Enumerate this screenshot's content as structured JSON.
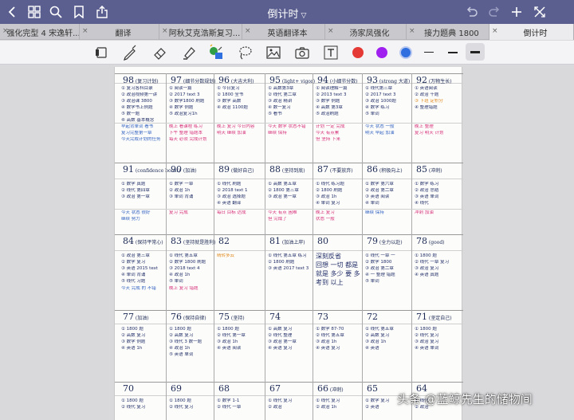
{
  "window": {
    "title": "倒计时"
  },
  "tabs": [
    {
      "label": "强化完型 4 宋逸轩..."
    },
    {
      "label": "翻译"
    },
    {
      "label": "阿秋艾克浩斯复习..."
    },
    {
      "label": "英语翻译本"
    },
    {
      "label": "汤家凤强化"
    },
    {
      "label": "接力题典 1800"
    },
    {
      "label": "倒计时"
    }
  ],
  "colors": {
    "titlebar": "#5b5f8f",
    "red": "#e53935",
    "purple": "#a020f0",
    "blue": "#2f6fe0"
  },
  "page": {
    "row1": {
      "heads": [
        "98",
        "97",
        "96",
        "95",
        "94",
        "93",
        "92"
      ],
      "subs": [
        "(复习计划)",
        "(细节分数规划)",
        "(大吉大利)",
        "(light+ vigor)",
        "(小细节分数)",
        "(strong 大道)",
        "(万物生长)"
      ],
      "lines": [
        [
          "① 复习各科目录",
          "② 政治视频第一讲",
          "③ 政治课 3800",
          "④ 数学书上例题",
          "⑤ 数一题",
          "⑥ 高数 基本概念"
        ],
        [
          "① 阅读一篇",
          "② 2017 text 3",
          "③ 数学1800 刷题",
          "④ 数学 例题",
          "⑤ 政治复习1h"
        ],
        [
          "① 今日复习",
          "② 1800 全书",
          "③ 数学 高数",
          "④ 政治 1100题"
        ],
        [
          "① 高数第3章",
          "② 线代 第二章",
          "③ 政治 精讲",
          "④ 数一复习",
          "⑤ 看书"
        ],
        [
          "① 阅读理解一篇",
          "② 2013 text 3",
          "③ 数学 例题",
          "④ 高数 第3章",
          "⑤ 政治刷题"
        ],
        [
          "① 线代第三章",
          "② 2017 text 3",
          "③ 政治 1000题",
          "④ 数学 练习",
          "⑤ 单词"
        ],
        [
          "① 英语阅读",
          "② 政治 千题",
          "③ 下班 定积分",
          "④ 整理错题"
        ]
      ],
      "notes": [
        [
          "早起背单词 看书",
          "复习完整第一章",
          "今天完成计划的任务"
        ],
        [
          "晚上 看课程 练习",
          "下午 整理 错题本",
          "每天 必须 完成计划"
        ],
        [
          "晚上 复习 今日内容",
          "明天 继续 加油"
        ],
        [
          "今天 数学 状态不错",
          "继续 保持"
        ],
        [
          "计划 一定 完成",
          "今天 有点累",
          "但 坚持 下来"
        ],
        [
          "今天 状态 一般",
          "明天 早起 加油"
        ],
        [
          "晚上 整理",
          "复习 明天 计划"
        ]
      ]
    },
    "row2": {
      "heads": [
        "91",
        "90",
        "89",
        "88",
        "87",
        "86",
        "85"
      ],
      "subs": [
        "(confidence boost)",
        "(加油)",
        "(做好自己)",
        "(坚持到底)",
        "(不要放弃)",
        "(积极向上)",
        "(冲刺)"
      ],
      "lines": [
        [
          "① 数学 真题",
          "② 线代 第四章",
          "③ 政治 第一章"
        ],
        [
          "① 数学 一章",
          "② 政治 1h",
          "③ 单词 背诵"
        ],
        [
          "① 线代 刷题",
          "② 2018 text 1",
          "③ 政治 选择题",
          "④ 英语 翻译"
        ],
        [
          "① 高数 第五章",
          "② 1800 第三章",
          "③ 政治 第一章"
        ],
        [
          "① 线代 练习题",
          "② 1800 刷题",
          "③ 政治 1h",
          "④ 单词 复习"
        ],
        [
          "① 数学 第六章",
          "② 政治 第二章",
          "③ 英语 阅读",
          "④ 单词"
        ],
        [
          "① 数学 练习",
          "② 政治 总结",
          "③ 英语 单词",
          "④ 线代"
        ]
      ],
      "notes": [
        [
          "今天 状态 很好",
          "继续 努力"
        ],
        [
          "复习 完成"
        ],
        [
          "每日 目标 达成"
        ],
        [
          "今天 有点 困难",
          "但 完成了"
        ],
        [
          "晚上 复习",
          "状态 一般"
        ],
        [
          "继续 保持"
        ],
        [
          "冲刺 加油"
        ]
      ]
    },
    "row3": {
      "heads": [
        "84",
        "83",
        "82",
        "81",
        "80",
        "79",
        "78"
      ],
      "subs": [
        "(保持平常心)",
        "(坚持就是胜利)",
        "",
        "(加油上岸)",
        "",
        "(全力以赴)",
        "(good)"
      ],
      "lines": [
        [
          "① 政治 第三章",
          "② 数学 复习",
          "③ 英语 2015 text",
          "④ 单词 背诵",
          "⑤ 线代 习题"
        ],
        [
          "① 线代 第五章",
          "② 数学 1800 刷题",
          "③ 2018 text 4",
          "④ 政治 1h",
          "⑤ 单词"
        ],
        [
          "晴转多云"
        ],
        [
          "① 线代 第五章 练习",
          "② 1800 刷题",
          "③ 英语 2017 text 3"
        ],
        [
          "深刻反省",
          "回想 一切 都是",
          "就是 多少 要 多",
          "考到 以上"
        ],
        [
          "① 线代 一章 一",
          "② 数学 1800",
          "③ 政治 第二章",
          "④ 一 整理 错题",
          "⑤ 单词"
        ],
        [
          "① 1800 题",
          "② 线代 一章 复习",
          "③ 政治 复习",
          "④ 英语 真题"
        ]
      ],
      "notes": [
        [
          "今天 完成 的 不错"
        ],
        [
          "晚上 复习 错题"
        ],
        [
          ""
        ],
        [
          ""
        ],
        [
          ""
        ],
        [
          ""
        ],
        [
          ""
        ]
      ]
    },
    "row4": {
      "heads": [
        "77",
        "76",
        "75",
        "74",
        "73",
        "72",
        "71"
      ],
      "subs": [
        "(加油)",
        "(保持自律)",
        "(坚持)",
        "",
        "",
        "",
        "(坚定自己)"
      ],
      "lines": [
        [
          "① 1800 题",
          "② 高数 复习",
          "③ 数学 例题",
          "④ 英语 1h"
        ],
        [
          "① 1800 题",
          "② 高数 复习",
          "③ 线代 3 数一题",
          "④ 政治 1h",
          "⑤ 英语 单词"
        ],
        [
          "① 1800 题",
          "② 线代 第一章",
          "③ 政治 1h",
          "④ 英语 阅读"
        ],
        [
          "① 高数 复习",
          "② 线代 整理",
          "③ 政治 第一章",
          "④ 英语 复习"
        ],
        [
          "① 数学 87-70",
          "② 线代 第五章",
          "③ 政治 1h",
          "④ 英语 复习"
        ],
        [
          "① 线代 第五章",
          "② 高数 复习",
          "③ 政治 1h",
          "④ 英语"
        ],
        [
          "① 1800 题",
          "② 线代 复习",
          "③ 政治 复习",
          "④ 英语 单词"
        ]
      ],
      "notes": [
        [
          ""
        ],
        [
          ""
        ],
        [
          ""
        ],
        [
          ""
        ],
        [
          ""
        ],
        [
          ""
        ],
        [
          ""
        ]
      ]
    },
    "row5": {
      "heads": [
        "70",
        "69",
        "68",
        "67",
        "66",
        "65",
        "64"
      ],
      "subs": [
        "",
        "",
        "",
        "",
        "(冲刺)",
        "",
        ""
      ],
      "lines": [
        [
          "① 1800 题",
          "② 线代 复习"
        ],
        [
          "① 1800 题",
          "② 线代 复习"
        ],
        [
          "① 数学 1-1",
          "② 线代 一章"
        ],
        [
          "① 线代 复习",
          "② 政治"
        ],
        [
          "① 线代 复习",
          "② 政治 1h"
        ],
        [
          "① 数学 复习",
          "② 英语"
        ],
        [
          "① 线代",
          "② 政治"
        ]
      ]
    }
  },
  "watermark": "头条 @蓝鲸先生的储物间"
}
